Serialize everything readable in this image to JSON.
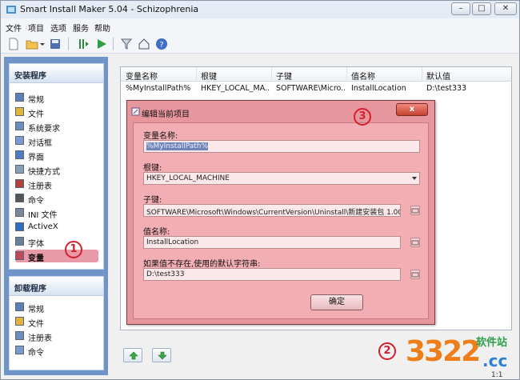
{
  "window": {
    "title": "Smart Install Maker 5.04 - Schizophrenia",
    "controls": {
      "minimize": "–",
      "maximize": "□",
      "close": "✕"
    }
  },
  "menu": [
    "文件",
    "项目",
    "选项",
    "服务",
    "帮助"
  ],
  "toolbar": {
    "icons": [
      "new-file-icon",
      "open-folder-icon",
      "dropdown-arrow-icon",
      "save-icon",
      "build-icon",
      "run-icon",
      "filter-icon",
      "home-icon",
      "help-icon"
    ]
  },
  "install_group": {
    "title": "安装程序",
    "items": [
      {
        "label": "常规",
        "icon": "general-icon"
      },
      {
        "label": "文件",
        "icon": "files-icon"
      },
      {
        "label": "系统要求",
        "icon": "requirements-icon"
      },
      {
        "label": "对话框",
        "icon": "dialogs-icon"
      },
      {
        "label": "界面",
        "icon": "interface-icon"
      },
      {
        "label": "快捷方式",
        "icon": "shortcuts-icon"
      },
      {
        "label": "注册表",
        "icon": "registry-icon"
      },
      {
        "label": "命令",
        "icon": "commands-icon"
      },
      {
        "label": "INI 文件",
        "icon": "ini-file-icon"
      },
      {
        "label": "ActiveX",
        "icon": "activex-icon"
      },
      {
        "label": "字体",
        "icon": "fonts-icon"
      },
      {
        "label": "变量",
        "icon": "variables-icon"
      }
    ],
    "active_index": 11
  },
  "uninstall_group": {
    "title": "卸载程序",
    "items": [
      {
        "label": "常规",
        "icon": "general-icon"
      },
      {
        "label": "文件",
        "icon": "files-icon"
      },
      {
        "label": "注册表",
        "icon": "registry-icon"
      },
      {
        "label": "命令",
        "icon": "commands-icon"
      }
    ]
  },
  "list": {
    "columns": [
      "变量名称",
      "根键",
      "子键",
      "值名称",
      "默认值"
    ],
    "rows": [
      [
        "%MyInstallPath%",
        "HKEY_LOCAL_MA...",
        "SOFTWARE\\Micro...",
        "InstallLocation",
        "D:\\test333"
      ]
    ]
  },
  "dialog": {
    "title": "编辑当前项目",
    "close_label": "x",
    "fields": {
      "var_name_label": "变量名称:",
      "var_name_value": "%MyInstallPath%",
      "root_key_label": "根键:",
      "root_key_value": "HKEY_LOCAL_MACHINE",
      "subkey_label": "子键:",
      "subkey_value": "SOFTWARE\\Microsoft\\Windows\\CurrentVersion\\Uninstall\\新建安装包 1.00",
      "value_name_label": "值名称:",
      "value_name_value": "InstallLocation",
      "default_label": "如果值不存在,使用的默认字符串:",
      "default_value": "D:\\test333"
    },
    "ok_label": "确定"
  },
  "annotations": [
    "1",
    "2",
    "3"
  ],
  "watermark": {
    "number": "3322",
    "suffix": ".cc",
    "cn": "软件站",
    "icon_char": "a"
  },
  "status": {
    "zoom": "1:1"
  },
  "colors": {
    "dialog_tint": "#e8969e",
    "panel_blue": "#6f94c9",
    "annotation_red": "#d3202c"
  }
}
